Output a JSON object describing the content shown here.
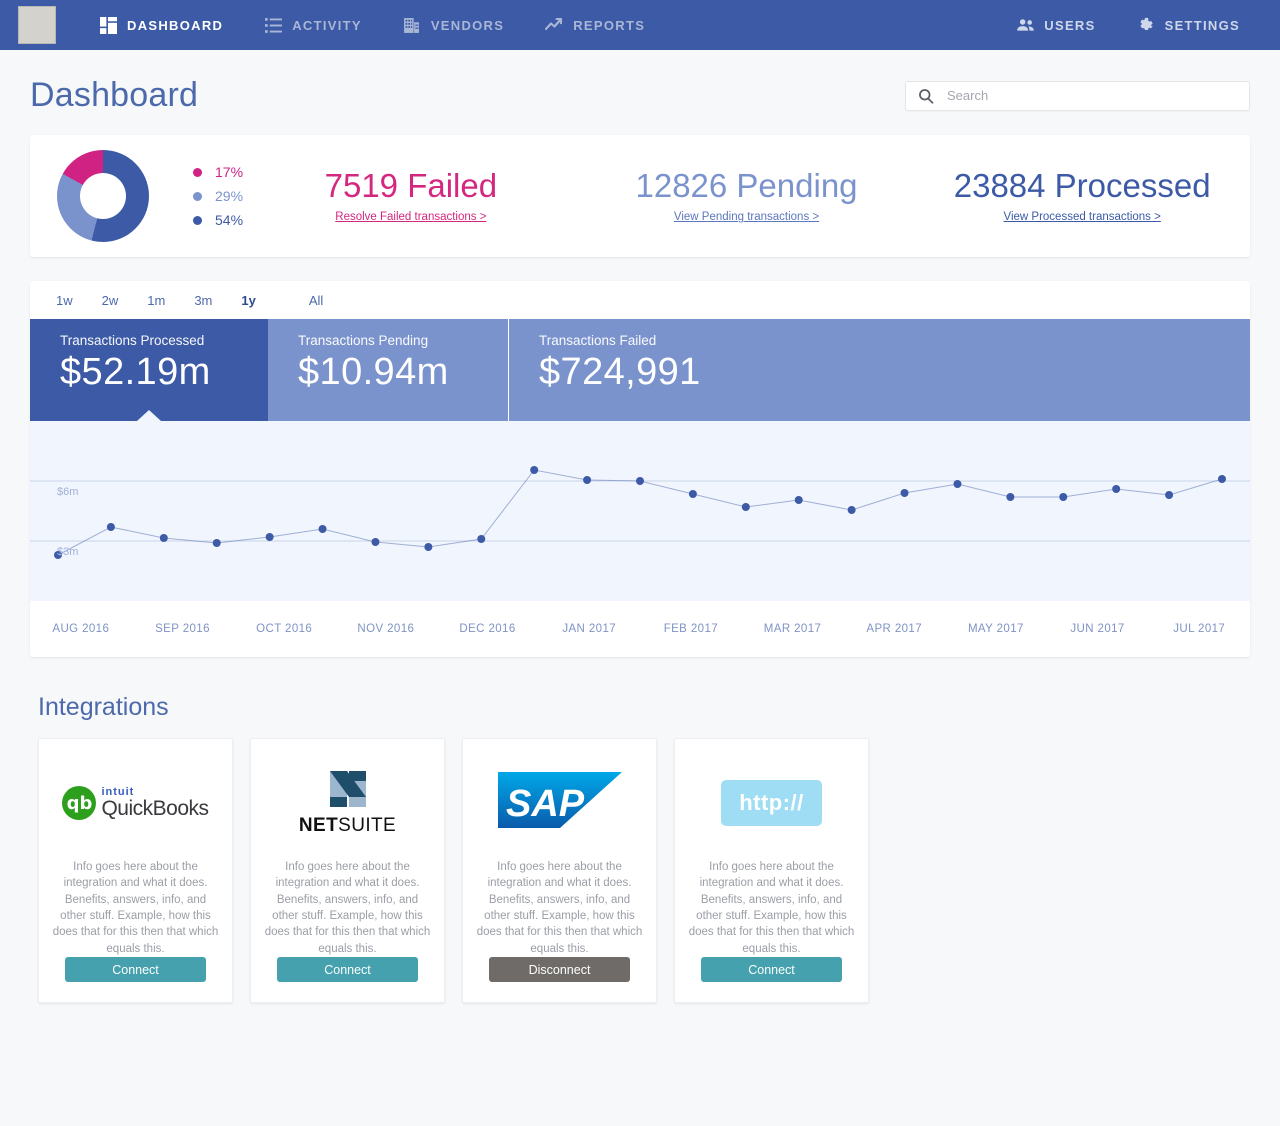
{
  "nav": {
    "logo_alt": "company-logo",
    "items": [
      {
        "label": "DASHBOARD",
        "icon": "grid-icon",
        "active": true
      },
      {
        "label": "ACTIVITY",
        "icon": "list-icon",
        "active": false
      },
      {
        "label": "VENDORS",
        "icon": "building-icon",
        "active": false
      },
      {
        "label": "REPORTS",
        "icon": "trending-up-icon",
        "active": false
      }
    ],
    "right_items": [
      {
        "label": "USERS",
        "icon": "people-icon"
      },
      {
        "label": "SETTINGS",
        "icon": "gear-icon"
      }
    ]
  },
  "header": {
    "title": "Dashboard",
    "search_placeholder": "Search",
    "search_value": ""
  },
  "summary": {
    "donut": {
      "segments": [
        {
          "percent_label": "17%",
          "value": 17,
          "color": "#cf2283"
        },
        {
          "percent_label": "29%",
          "value": 29,
          "color": "#7b93cd"
        },
        {
          "percent_label": "54%",
          "value": 54,
          "color": "#3c5aa6"
        }
      ]
    },
    "stats": [
      {
        "count": "7519",
        "label": "Failed",
        "value_text": "7519 Failed",
        "link": "Resolve Failed transactions >",
        "color": "#d4277f"
      },
      {
        "count": "12826",
        "label": "Pending",
        "value_text": "12826 Pending",
        "link": "View Pending transactions >",
        "color": "#7b93cd"
      },
      {
        "count": "23884",
        "label": "Processed",
        "value_text": "23884 Processed",
        "link": "View Processed transactions >",
        "color": "#3c5aa6"
      }
    ]
  },
  "chart_panel": {
    "ranges": [
      {
        "label": "1w",
        "active": false
      },
      {
        "label": "2w",
        "active": false
      },
      {
        "label": "1m",
        "active": false
      },
      {
        "label": "3m",
        "active": false
      },
      {
        "label": "1y",
        "active": true
      },
      {
        "label": "All",
        "active": false
      }
    ],
    "tiles": [
      {
        "label": "Transactions Processed",
        "value": "$52.19m",
        "active": true
      },
      {
        "label": "Transactions Pending",
        "value": "$10.94m",
        "active": false
      },
      {
        "label": "Transactions Failed",
        "value": "$724,991",
        "active": false
      }
    ]
  },
  "chart_data": {
    "type": "line",
    "title": "Transactions Processed",
    "xlabel": "",
    "ylabel": "",
    "ylim": [
      0,
      9
    ],
    "yticks": [
      3,
      6
    ],
    "ytick_labels": [
      "$3m",
      "$6m"
    ],
    "grid": true,
    "legend_position": "none",
    "unit": "millions USD",
    "categories": [
      "AUG 2016",
      "SEP 2016",
      "OCT 2016",
      "NOV 2016",
      "DEC 2016",
      "JAN 2017",
      "FEB 2017",
      "MAR 2017",
      "APR 2017",
      "MAY 2017",
      "JUN 2017",
      "JUL 2017"
    ],
    "x": [
      0,
      0.5,
      1,
      1.5,
      2,
      2.5,
      3,
      3.5,
      4,
      4.5,
      5,
      5.5,
      6,
      6.5,
      7,
      7.5,
      8,
      8.5,
      9,
      9.5,
      10,
      10.5,
      11
    ],
    "series": [
      {
        "name": "Transactions Processed",
        "color": "#3c5aa6",
        "values": [
          2.3,
          3.7,
          3.15,
          2.9,
          3.2,
          3.6,
          2.95,
          2.7,
          3.1,
          6.55,
          6.05,
          6.0,
          5.35,
          4.7,
          5.05,
          4.55,
          5.4,
          5.85,
          5.2,
          5.2,
          5.6,
          5.3,
          6.1
        ]
      }
    ]
  },
  "integrations": {
    "title": "Integrations",
    "description": "Info goes here about the integration and what it does. Benefits, answers, info, and other stuff. Example, how this does that for this then that which equals this.",
    "cards": [
      {
        "logo": "quickbooks-logo",
        "brand_top": "intuit",
        "brand_name": "QuickBooks",
        "button": "Connect",
        "state": "disconnected"
      },
      {
        "logo": "netsuite-logo",
        "brand_bold": "NET",
        "brand_rest": "SUITE",
        "button": "Connect",
        "state": "disconnected"
      },
      {
        "logo": "sap-logo",
        "brand_name": "SAP",
        "button": "Disconnect",
        "state": "connected"
      },
      {
        "logo": "http-logo",
        "brand_name": "http://",
        "button": "Connect",
        "state": "disconnected"
      }
    ]
  },
  "colors": {
    "nav_bg": "#3c5aa6",
    "accent_blue": "#3c5aa6",
    "light_blue": "#7b93cd",
    "pink": "#d4277f",
    "teal": "#45a1ae",
    "gray_button": "#6e6b68",
    "page_bg": "#f7f8fa",
    "plot_bg": "#f1f5fd"
  }
}
